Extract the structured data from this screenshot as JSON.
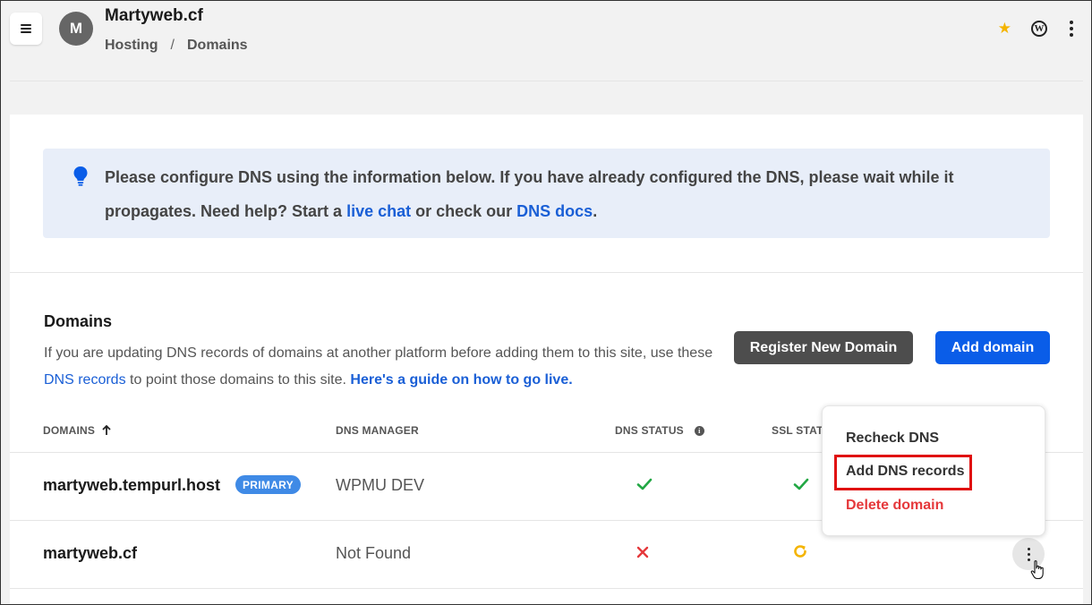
{
  "header": {
    "avatar_letter": "M",
    "site_title": "Martyweb.cf",
    "breadcrumb": [
      "Hosting",
      "Domains"
    ],
    "breadcrumb_sep": "/"
  },
  "notice": {
    "text_1": "Please configure DNS using the information below. If you have already configured the DNS, please wait while it propagates. Need help? Start a ",
    "link_chat": "live chat",
    "text_2": " or check our ",
    "link_docs": "DNS docs",
    "text_3": "."
  },
  "domains": {
    "title": "Domains",
    "desc_1": "If you are updating DNS records of domains at another platform before adding them to this site, use these ",
    "link_records": "DNS records",
    "desc_2": " to point those domains to this site. ",
    "link_guide": "Here's a guide on how to go live.",
    "register_label": "Register New Domain",
    "add_label": "Add domain"
  },
  "table": {
    "headers": {
      "domains": "DOMAINS",
      "dns_manager": "DNS MANAGER",
      "dns_status": "DNS STATUS",
      "ssl_status": "SSL STAT"
    },
    "rows": [
      {
        "domain": "martyweb.tempurl.host",
        "badge": "PRIMARY",
        "dns_manager": "WPMU DEV",
        "dns_status": "ok",
        "ssl_status": "ok"
      },
      {
        "domain": "martyweb.cf",
        "badge": "",
        "dns_manager": "Not Found",
        "dns_status": "error",
        "ssl_status": "pending"
      }
    ]
  },
  "dropdown": {
    "items": [
      "Recheck DNS",
      "Add DNS records",
      "Delete domain"
    ],
    "highlighted": "Add DNS records"
  },
  "colors": {
    "accent": "#0a5de8",
    "link": "#1a5fd6",
    "success": "#22a744",
    "danger": "#e5383b",
    "warning": "#f4b400",
    "highlight_box": "#e01010"
  },
  "icons": {
    "menu": "hamburger-icon",
    "favorite": "star-icon",
    "wordpress": "wordpress-icon",
    "more": "kebab-icon",
    "notice": "bulb-icon",
    "sort": "sort-arrow-up-icon",
    "info": "info-icon",
    "ok": "check-icon",
    "error": "cross-icon",
    "pending": "sync-icon"
  }
}
